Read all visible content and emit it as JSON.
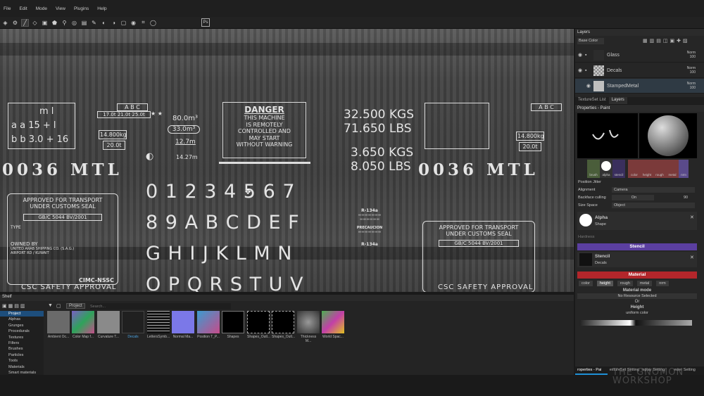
{
  "menu": [
    "File",
    "Edit",
    "Mode",
    "View",
    "Plugins",
    "Help"
  ],
  "toolbar": {
    "ps_label": "Ps"
  },
  "viewport": {
    "stencil": {
      "mlt_left_top": "m l",
      "mlt_left_mid": "a a 15 + l",
      "mlt_left_bot": "b b 3.0 + 16",
      "abc_row1": "A  B  C",
      "abc_row2": "17.0t 21.0t 25.0t",
      "stars": "★ ★",
      "kg_box": "14.800kg",
      "t_box": "20.0t",
      "vol1": "80.0m³",
      "vol2": "33.0m³",
      "len1": "12.7m",
      "len2": "14.27m",
      "danger_title": "DANGER",
      "danger_body": "THIS MACHINE\nIS REMOTELY\nCONTROLLED AND\nMAY START\nWITHOUT WARNING",
      "kgs1": "32.500 KGS",
      "lbs1": "71.650 LBS",
      "kgs2": "3.650 KGS",
      "lbs2": "8.050 LBS",
      "mtl_left": "0036 MTL",
      "mtl_right": "0036 MTL",
      "approved_l1": "APPROVED FOR TRANSPORT",
      "approved_l2": "UNDER CUSTOMS SEAL",
      "gb_code": "GB/C 5044 BV/2001",
      "type_label": "TYPE",
      "digits": "0 1 2 3 4 5 6 7",
      "letters1": "8 9 A B C D E F",
      "letters2": "G H I J K L M N",
      "letters3": "O P Q R S T U V",
      "owned_by": "OWNED BY",
      "owner_addr": "UNITED ARAB SHIPPING CO. (S.A.G.)\nAIRPORT RD / KUWAIT",
      "cimc": "CIMC-NSSC",
      "csc": "CSC SAFETY APPROVAL",
      "r134a": "R-134a",
      "precaucion": "PRECAUCION",
      "right_kg": "14.800kg",
      "right_t": "20.0t",
      "right_abc": "A  B  C",
      "right_gb": "GB/C 5044 BV/2001",
      "right_approved_l1": "APPROVED FOR TRANSPORT",
      "right_approved_l2": "UNDER CUSTOMS SEAL",
      "right_csc": "CSC SAFETY APPROVAL"
    }
  },
  "layers_panel": {
    "title": "Layers",
    "channel": "Base Color",
    "layers": [
      {
        "name": "Glass",
        "blend": "Norm",
        "opacity": "100"
      },
      {
        "name": "Decals",
        "blend": "Norm",
        "opacity": "100"
      },
      {
        "name": "StampedMetal",
        "blend": "Norm",
        "opacity": "100"
      }
    ],
    "tabs": [
      "TextureSet List",
      "Layers"
    ]
  },
  "properties": {
    "title": "Properties - Paint",
    "slots": [
      "brush",
      "alpha",
      "stencil",
      "color",
      "height",
      "rough",
      "metal",
      "nrm"
    ],
    "rows": [
      {
        "label": "Position Jitter",
        "value": ""
      },
      {
        "label": "Alignment",
        "value": "Camera"
      },
      {
        "label": "Backface culling",
        "value": "On"
      },
      {
        "label": "Size Space",
        "value": "Object"
      }
    ],
    "backface_value": "90",
    "alpha_label": "Alpha",
    "alpha_sub": "Shape",
    "hardness_label": "Hardness",
    "stencil_section": "Stencil",
    "stencil_name": "Stencil",
    "stencil_sub": "Decals",
    "material_section": "Material",
    "material_chips": [
      "color",
      "height",
      "rough",
      "metal",
      "nrm"
    ],
    "material_mode_label": "Material mode",
    "material_mode_value": "No Resource Selected",
    "or_label": "Or",
    "height_label": "Height",
    "height_value": "uniform color",
    "bottom_tabs": [
      "roperties - Pai",
      "extureSet Setting",
      "isplay Setting",
      "ewer Setting"
    ]
  },
  "shelf": {
    "title": "Shelf",
    "tab": "Project",
    "search_placeholder": "Search...",
    "categories": [
      "Project",
      "Alphas",
      "Grunges",
      "Procedurals",
      "Textures",
      "Filters",
      "Brushes",
      "Particles",
      "Tools",
      "Materials",
      "Smart materials"
    ],
    "assets": [
      {
        "label": "Ambient Oc...",
        "color": "#6a6a6a"
      },
      {
        "label": "Color Map f...",
        "color": "#7a5fc4"
      },
      {
        "label": "Curvature T...",
        "color": "#8a8a8a"
      },
      {
        "label": "Decals",
        "color": "#202020"
      },
      {
        "label": "LettersSymb...",
        "color": "#111111"
      },
      {
        "label": "Normal Ma...",
        "color": "#7b78e8"
      },
      {
        "label": "Position T_P...",
        "color": "#3b9bd0"
      },
      {
        "label": "Shapes",
        "color": "#000000"
      },
      {
        "label": "Shapes_Outl...",
        "color": "#000000"
      },
      {
        "label": "Shapes_Outl...",
        "color": "#000000"
      },
      {
        "label": "Thickness M...",
        "color": "#555555"
      },
      {
        "label": "World Spac...",
        "color": "#4caf50"
      }
    ]
  },
  "watermark": {
    "line1": "THE GNOMON",
    "line2": "WORKSHOP"
  },
  "colors": {
    "accent": "#1e90d6",
    "stencil_bar": "#5b3fa0",
    "material_bar": "#b3262b"
  }
}
